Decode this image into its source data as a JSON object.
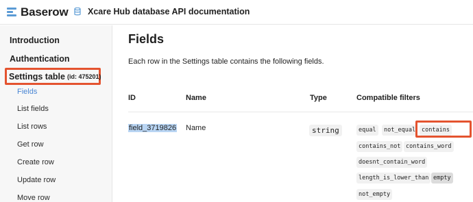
{
  "header": {
    "app_name": "Baserow",
    "db_title": "Xcare Hub database API documentation",
    "colors": {
      "logo": "#5b9bd5",
      "db_icon": "#5b9bd5"
    }
  },
  "sidebar": {
    "introduction": "Introduction",
    "authentication": "Authentication",
    "table_name": "Settings table",
    "table_id": "(id: 475201)",
    "items": [
      {
        "label": "Fields",
        "active": true
      },
      {
        "label": "List fields"
      },
      {
        "label": "List rows"
      },
      {
        "label": "Get row"
      },
      {
        "label": "Create row"
      },
      {
        "label": "Update row"
      },
      {
        "label": "Move row"
      }
    ],
    "colors": {
      "highlight_border": "#e4532f",
      "active": "#4a86d4"
    }
  },
  "main": {
    "title": "Fields",
    "intro": "Each row in the Settings table contains the following fields.",
    "columns": [
      "ID",
      "Name",
      "Type",
      "Compatible filters"
    ],
    "row": {
      "id": "field_3719826",
      "name": "Name",
      "type": "string",
      "filters": [
        "equal",
        "not_equal",
        "contains",
        "contains_not",
        "contains_word",
        "doesnt_contain_word",
        "length_is_lower_than",
        "empty",
        "not_empty"
      ],
      "highlighted_filter": "contains"
    }
  }
}
